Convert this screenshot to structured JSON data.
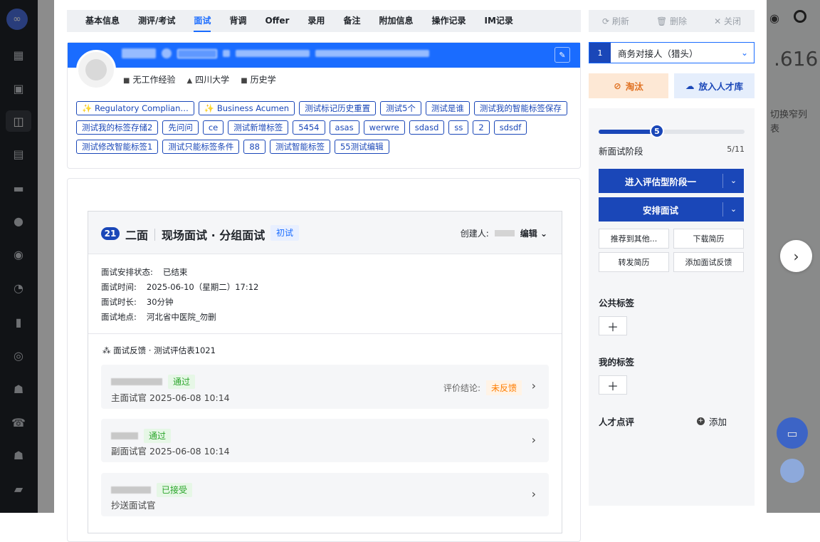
{
  "sidebar": {
    "icons": [
      "logo-icon",
      "grid-icon",
      "briefcase-icon",
      "candidate-icon",
      "calendar-icon",
      "id-card-icon",
      "wechat-icon",
      "record-icon",
      "pie-chart-icon",
      "bar-chart-icon",
      "at-icon",
      "users-icon",
      "phone-icon",
      "people-icon",
      "chat-icon"
    ]
  },
  "tabs": [
    "基本信息",
    "测评/考试",
    "面试",
    "背调",
    "Offer",
    "录用",
    "备注",
    "附加信息",
    "操作记录",
    "IM记录"
  ],
  "active_tab": "面试",
  "top_actions": {
    "refresh": "⟳ 刷新",
    "delete": "🗑 删除",
    "close": "✕ 关闭"
  },
  "profile": {
    "info": [
      {
        "icon": "briefcase-icon",
        "text": "无工作经验"
      },
      {
        "icon": "school-icon",
        "text": "四川大学"
      },
      {
        "icon": "book-icon",
        "text": "历史学"
      }
    ],
    "tags": [
      "✨ Regulatory Complian…",
      "✨ Business Acumen",
      "测试标记历史重置",
      "测试5个",
      "测试是谁",
      "测试我的智能标签保存",
      "测试我的标签存储2",
      "先问问",
      "ce",
      "测试新增标签",
      "5454",
      "asas",
      "werwre",
      "sdasd",
      "ss",
      "2",
      "sdsdf",
      "测试修改智能标签1",
      "测试只能标签条件",
      "88",
      "测试智能标签",
      "55测试编辑"
    ]
  },
  "interview": {
    "round": "21",
    "title": "二面",
    "subtitle": "现场面试 · 分组面试",
    "badge": "初试",
    "creator_label": "创建人:",
    "edit_label": "编辑",
    "rows": [
      {
        "k": "面试安排状态:",
        "v": "已结束"
      },
      {
        "k": "面试时间:",
        "v": "2025-06-10（星期二）17:12"
      },
      {
        "k": "面试时长:",
        "v": "30分钟"
      },
      {
        "k": "面试地点:",
        "v": "河北省中医院_勿删"
      }
    ],
    "feedback_title": "面试反馈 · 测试评估表1021",
    "feedback": [
      {
        "status": "通过",
        "role": "主面试官  2025-06-08 10:14",
        "conclusion_label": "评价结论:",
        "conclusion": "未反馈"
      },
      {
        "status": "通过",
        "role": "副面试官  2025-06-08 10:14"
      },
      {
        "status": "已接受",
        "role": "抄送面试官"
      }
    ]
  },
  "right": {
    "stage_no": "1",
    "stage_name": "商务对接人（猎头）",
    "btn_out": "淘汰",
    "btn_pool": "放入人才库",
    "progress_value": 5,
    "progress_total": 11,
    "stage_label": "新面试阶段",
    "stage_count": "5/11",
    "primary1": "进入评估型阶段一",
    "primary2": "安排面试",
    "small": [
      "推荐到其他...",
      "下载简历",
      "转发简历",
      "添加面试反馈"
    ],
    "public_tags": "公共标签",
    "my_tags": "我的标签",
    "comment": "人才点评",
    "add": "添加"
  },
  "background": {
    "number": ".616",
    "text1": "切换窄列",
    "text2": "表"
  }
}
